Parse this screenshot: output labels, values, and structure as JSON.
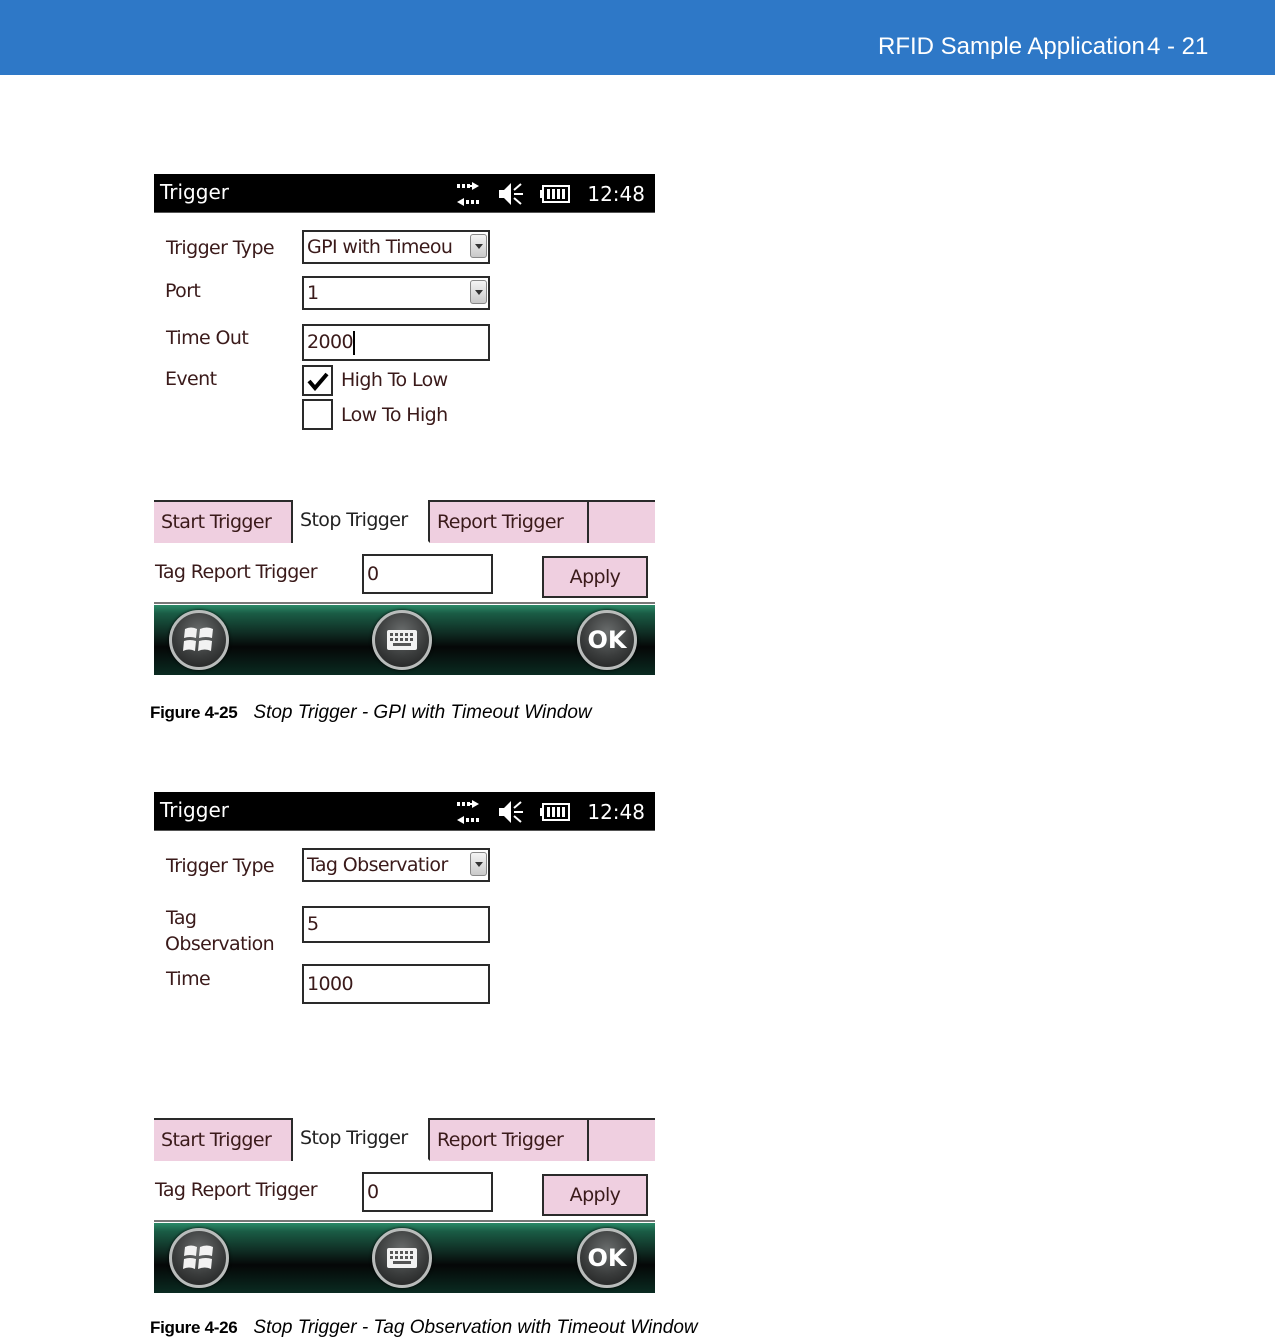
{
  "header": {
    "title": "RFID Sample Application",
    "page_number": "4 - 21",
    "bar_color": "#2e78c7"
  },
  "figures": [
    {
      "screen": {
        "title": "Trigger",
        "status_icons": [
          "connectivity-icon",
          "speaker-muted-icon",
          "battery-icon"
        ],
        "clock": "12:48",
        "form": {
          "trigger_type_label": "Trigger Type",
          "trigger_type_value": "GPI with Timeou",
          "port_label": "Port",
          "port_value": "1",
          "timeout_label": "Time Out",
          "timeout_value": "2000",
          "event_label": "Event",
          "events": [
            {
              "label": "High To Low",
              "checked": true
            },
            {
              "label": "Low To High",
              "checked": false
            }
          ]
        },
        "tabs": [
          {
            "label": "Start Trigger",
            "active": false
          },
          {
            "label": "Stop Trigger",
            "active": true
          },
          {
            "label": "Report Trigger",
            "active": false
          }
        ],
        "tag_report_trigger_label": "Tag Report Trigger",
        "tag_report_trigger_value": "0",
        "apply_label": "Apply",
        "taskbar": {
          "start": "windows-start-icon",
          "keyboard": "keyboard-icon",
          "ok_label": "OK"
        }
      },
      "caption": {
        "number": "Figure 4-25",
        "text": "Stop Trigger - GPI with Timeout Window"
      }
    },
    {
      "screen": {
        "title": "Trigger",
        "status_icons": [
          "connectivity-icon",
          "speaker-muted-icon",
          "battery-icon"
        ],
        "clock": "12:48",
        "form": {
          "trigger_type_label": "Trigger Type",
          "trigger_type_value": "Tag Observatior",
          "tag_observation_label_line1": "Tag",
          "tag_observation_label_line2": "Observation",
          "tag_observation_value": "5",
          "time_label": "Time",
          "time_value": "1000"
        },
        "tabs": [
          {
            "label": "Start Trigger",
            "active": false
          },
          {
            "label": "Stop Trigger",
            "active": true
          },
          {
            "label": "Report Trigger",
            "active": false
          }
        ],
        "tag_report_trigger_label": "Tag Report Trigger",
        "tag_report_trigger_value": "0",
        "apply_label": "Apply",
        "taskbar": {
          "start": "windows-start-icon",
          "keyboard": "keyboard-icon",
          "ok_label": "OK"
        }
      },
      "caption": {
        "number": "Figure 4-26",
        "text": "Stop Trigger - Tag Observation with Timeout Window"
      }
    }
  ],
  "colors": {
    "tab_pink": "#efcfe0",
    "text_maroon": "#3a1a1a",
    "taskbar_green": "#2b8a68"
  }
}
